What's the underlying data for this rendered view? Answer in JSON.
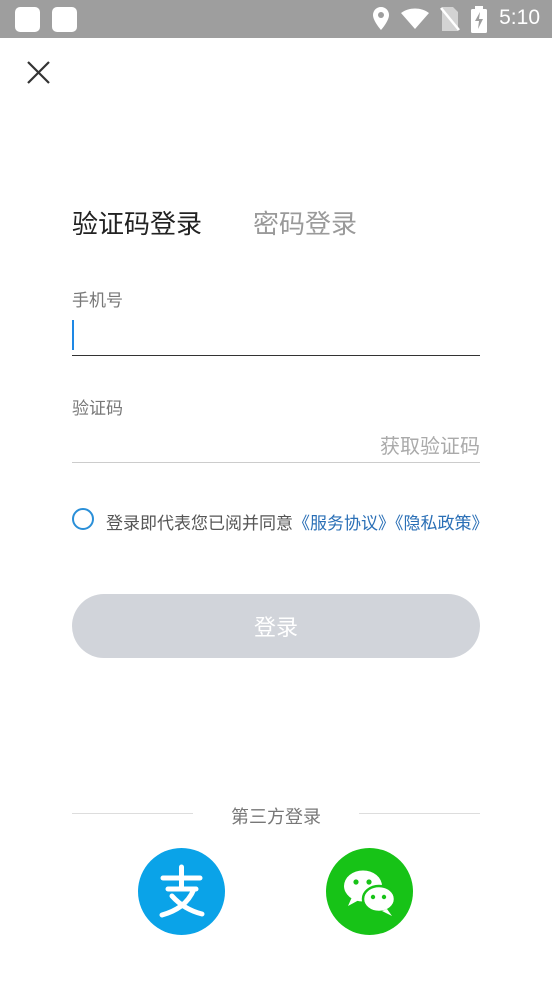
{
  "status_bar": {
    "time": "5:10",
    "icons": [
      "notification-square-icon",
      "notification-square-icon",
      "location-icon",
      "wifi-icon",
      "no-sim-icon",
      "battery-charging-icon"
    ]
  },
  "header": {
    "close_icon": "close-icon"
  },
  "tabs": [
    {
      "label": "验证码登录",
      "active": true
    },
    {
      "label": "密码登录",
      "active": false
    }
  ],
  "form": {
    "phone_label": "手机号",
    "phone_value": "",
    "code_label": "验证码",
    "code_value": "",
    "get_code_label": "获取验证码"
  },
  "agreement": {
    "checked": false,
    "text": "登录即代表您已阅并同意",
    "service_link": "《服务协议》",
    "privacy_link": "《隐私政策》"
  },
  "login_button": {
    "label": "登录"
  },
  "third_party": {
    "title": "第三方登录",
    "providers": [
      {
        "name": "alipay",
        "icon": "alipay-icon",
        "color": "#0aa3e8"
      },
      {
        "name": "wechat",
        "icon": "wechat-icon",
        "color": "#17c317"
      }
    ]
  },
  "colors": {
    "accent": "#2a8fd8",
    "link": "#2a6fb6",
    "button_disabled": "#d1d4da",
    "status_bar": "#9e9e9e"
  }
}
